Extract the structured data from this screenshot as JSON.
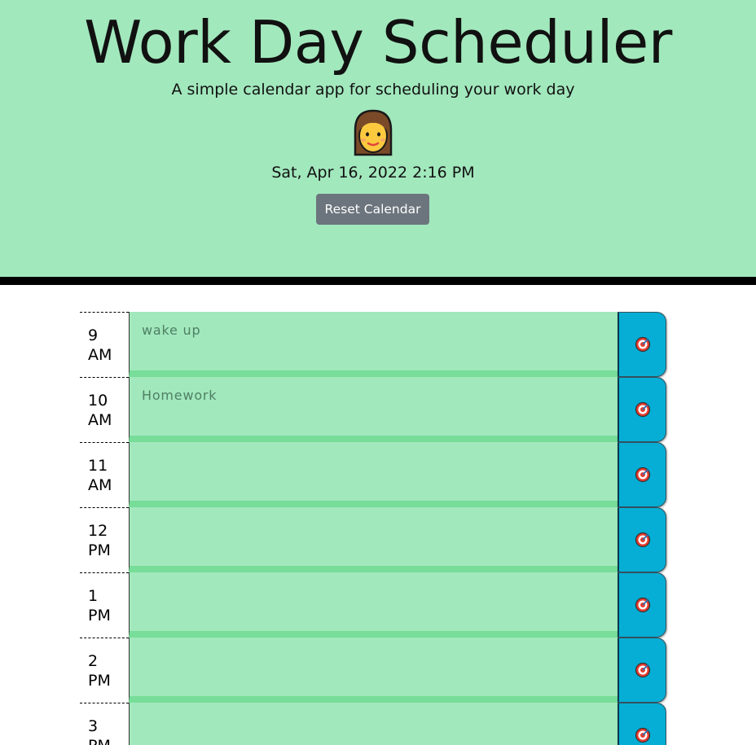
{
  "header": {
    "title": "Work Day Scheduler",
    "subtitle": "A simple calendar app for scheduling your work day",
    "avatar_icon": "woman-emoji-icon",
    "datetime": "Sat, Apr 16, 2022 2:16 PM",
    "reset_label": "Reset Calendar"
  },
  "colors": {
    "header_bg": "#a2e8bd",
    "divider": "#000000",
    "timeblock_bg": "#a2e8bd",
    "timeblock_border": "#77dd98",
    "save_button": "#06aed5",
    "reset_button": "#6c757d"
  },
  "schedule": [
    {
      "hour": "9",
      "period": "AM",
      "text": "wake up",
      "save_icon": "target-icon"
    },
    {
      "hour": "10",
      "period": "AM",
      "text": "Homework",
      "save_icon": "target-icon"
    },
    {
      "hour": "11",
      "period": "AM",
      "text": "",
      "save_icon": "target-icon"
    },
    {
      "hour": "12",
      "period": "PM",
      "text": "",
      "save_icon": "target-icon"
    },
    {
      "hour": "1",
      "period": "PM",
      "text": "",
      "save_icon": "target-icon"
    },
    {
      "hour": "2",
      "period": "PM",
      "text": "",
      "save_icon": "target-icon"
    },
    {
      "hour": "3",
      "period": "PM",
      "text": "",
      "save_icon": "target-icon"
    }
  ]
}
